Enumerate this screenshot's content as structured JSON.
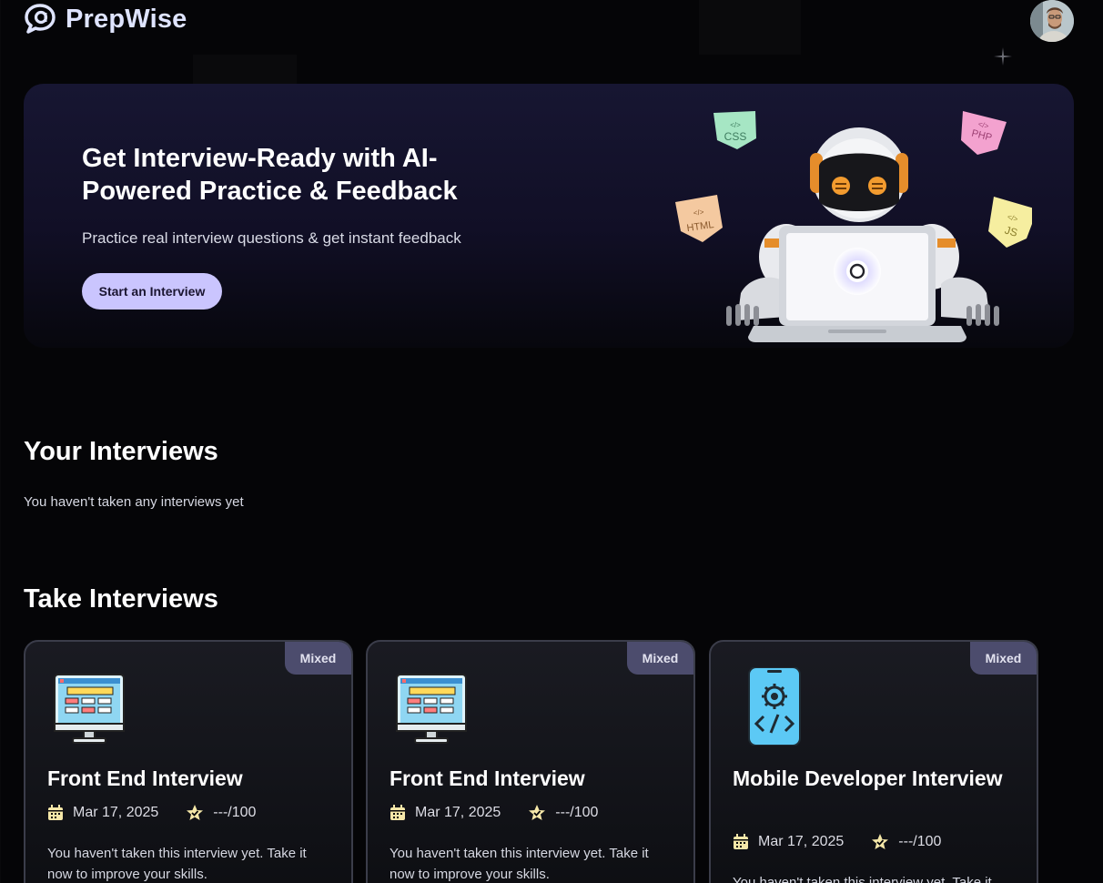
{
  "brand": {
    "name": "PrepWise"
  },
  "hero": {
    "title": "Get Interview-Ready with AI-Powered Practice & Feedback",
    "subtitle": "Practice real interview questions & get instant feedback",
    "cta_label": "Start an Interview",
    "tech_tags": [
      "CSS",
      "PHP",
      "HTML",
      "JS"
    ]
  },
  "your_interviews": {
    "title": "Your Interviews",
    "empty_message": "You haven't taken any interviews yet"
  },
  "take_interviews": {
    "title": "Take Interviews",
    "cards": [
      {
        "badge": "Mixed",
        "icon": "monitor-icon",
        "title": "Front End Interview",
        "date": "Mar 17, 2025",
        "score": "---/100",
        "description": "You haven't taken this interview yet. Take it now to improve your skills."
      },
      {
        "badge": "Mixed",
        "icon": "monitor-icon",
        "title": "Front End Interview",
        "date": "Mar 17, 2025",
        "score": "---/100",
        "description": "You haven't taken this interview yet. Take it now to improve your skills."
      },
      {
        "badge": "Mixed",
        "icon": "mobile-code-icon",
        "title": "Mobile Developer Interview",
        "date": "Mar 17, 2025",
        "score": "---/100",
        "description": "You haven't taken this interview yet. Take it now to improve your skills."
      }
    ]
  },
  "colors": {
    "background": "#050507",
    "accent": "#cac5fe",
    "logo": "#dfe4ff",
    "badge": "#4c4c6d",
    "card_border": "#3b3d4a",
    "icon_yellow": "#f5e7a8"
  }
}
